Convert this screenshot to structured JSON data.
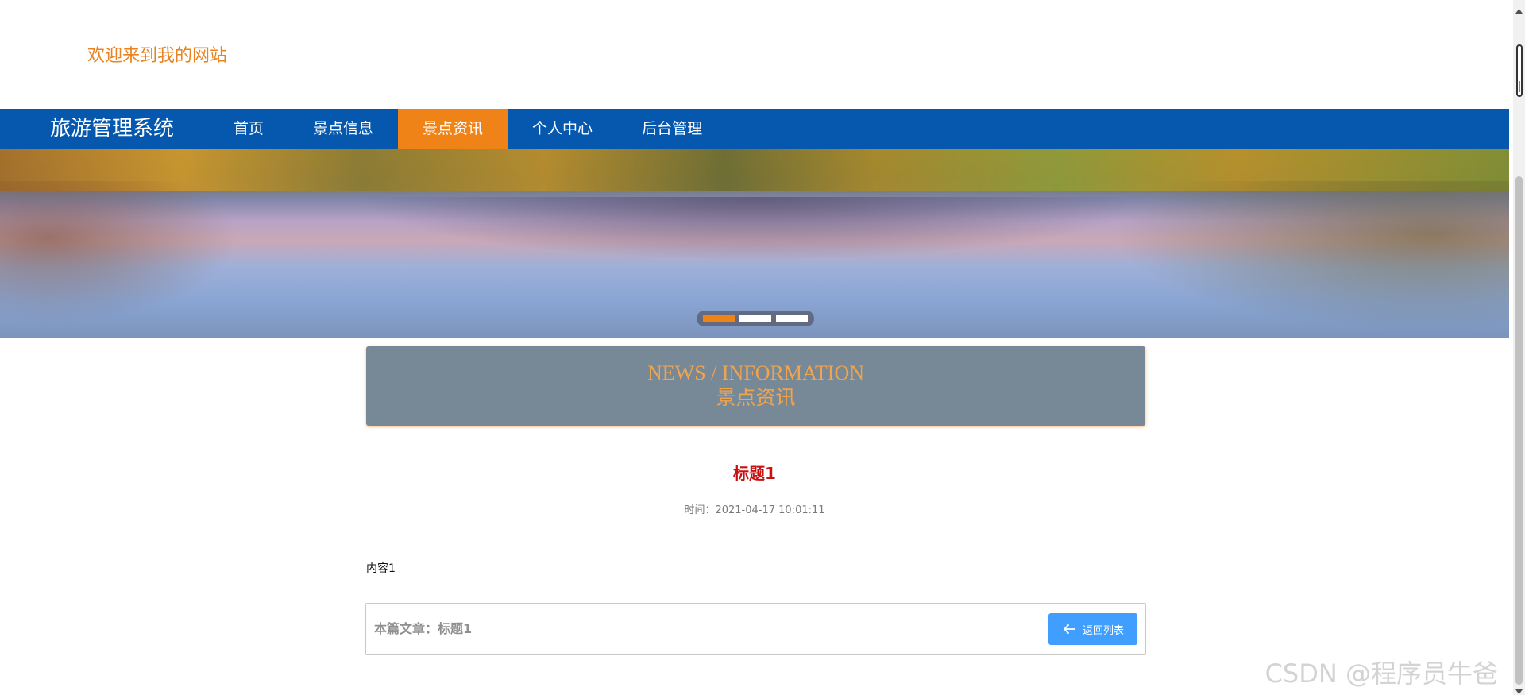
{
  "header": {
    "welcome_text": "欢迎来到我的网站"
  },
  "navbar": {
    "brand": "旅游管理系统",
    "items": [
      {
        "label": "首页",
        "active": false
      },
      {
        "label": "景点信息",
        "active": false
      },
      {
        "label": "景点资讯",
        "active": true
      },
      {
        "label": "个人中心",
        "active": false
      },
      {
        "label": "后台管理",
        "active": false
      }
    ]
  },
  "carousel": {
    "slide_count": 3,
    "active_index": 0
  },
  "section_header": {
    "english": "NEWS / INFORMATION",
    "chinese": "景点资讯"
  },
  "article": {
    "title": "标题1",
    "time_label": "时间：",
    "time_value": "2021-04-17 10:01:11",
    "content": "内容1"
  },
  "footer_bar": {
    "label": "本篇文章：",
    "title": "标题1",
    "back_button": "返回列表",
    "back_icon": "arrow-left-icon"
  },
  "watermark": "CSDN @程序员牛爸",
  "colors": {
    "accent": "#ef8318",
    "nav_bg": "#0558ad",
    "title_red": "#c90f0f",
    "button_blue": "#409eff",
    "section_bg": "#778896"
  }
}
